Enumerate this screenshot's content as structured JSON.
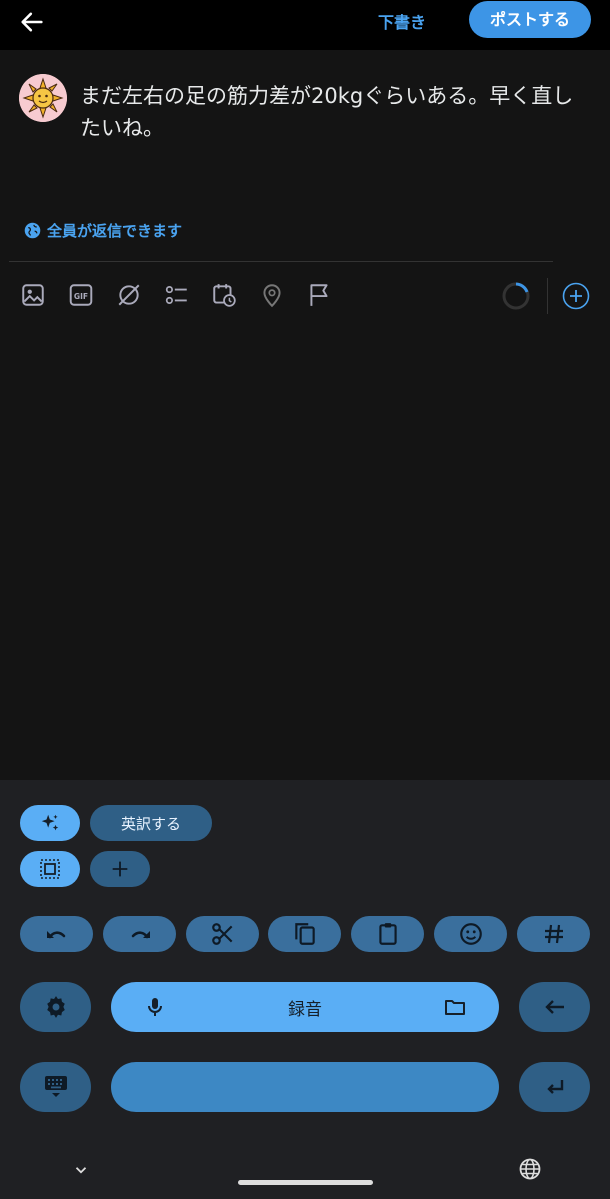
{
  "header": {
    "draft_label": "下書き",
    "post_label": "ポストする"
  },
  "composer": {
    "text": "まだ左右の足の筋力差が20kgぐらいある。早く直したいね。",
    "reply_setting": "全員が返信できます"
  },
  "toolbar": {
    "icons": [
      "image-icon",
      "gif-icon",
      "grok-icon",
      "poll-icon",
      "schedule-icon",
      "location-icon",
      "flag-icon"
    ]
  },
  "keyboard": {
    "translate_label": "英訳する",
    "record_label": "録音",
    "accent_color": "#5aaef5"
  }
}
